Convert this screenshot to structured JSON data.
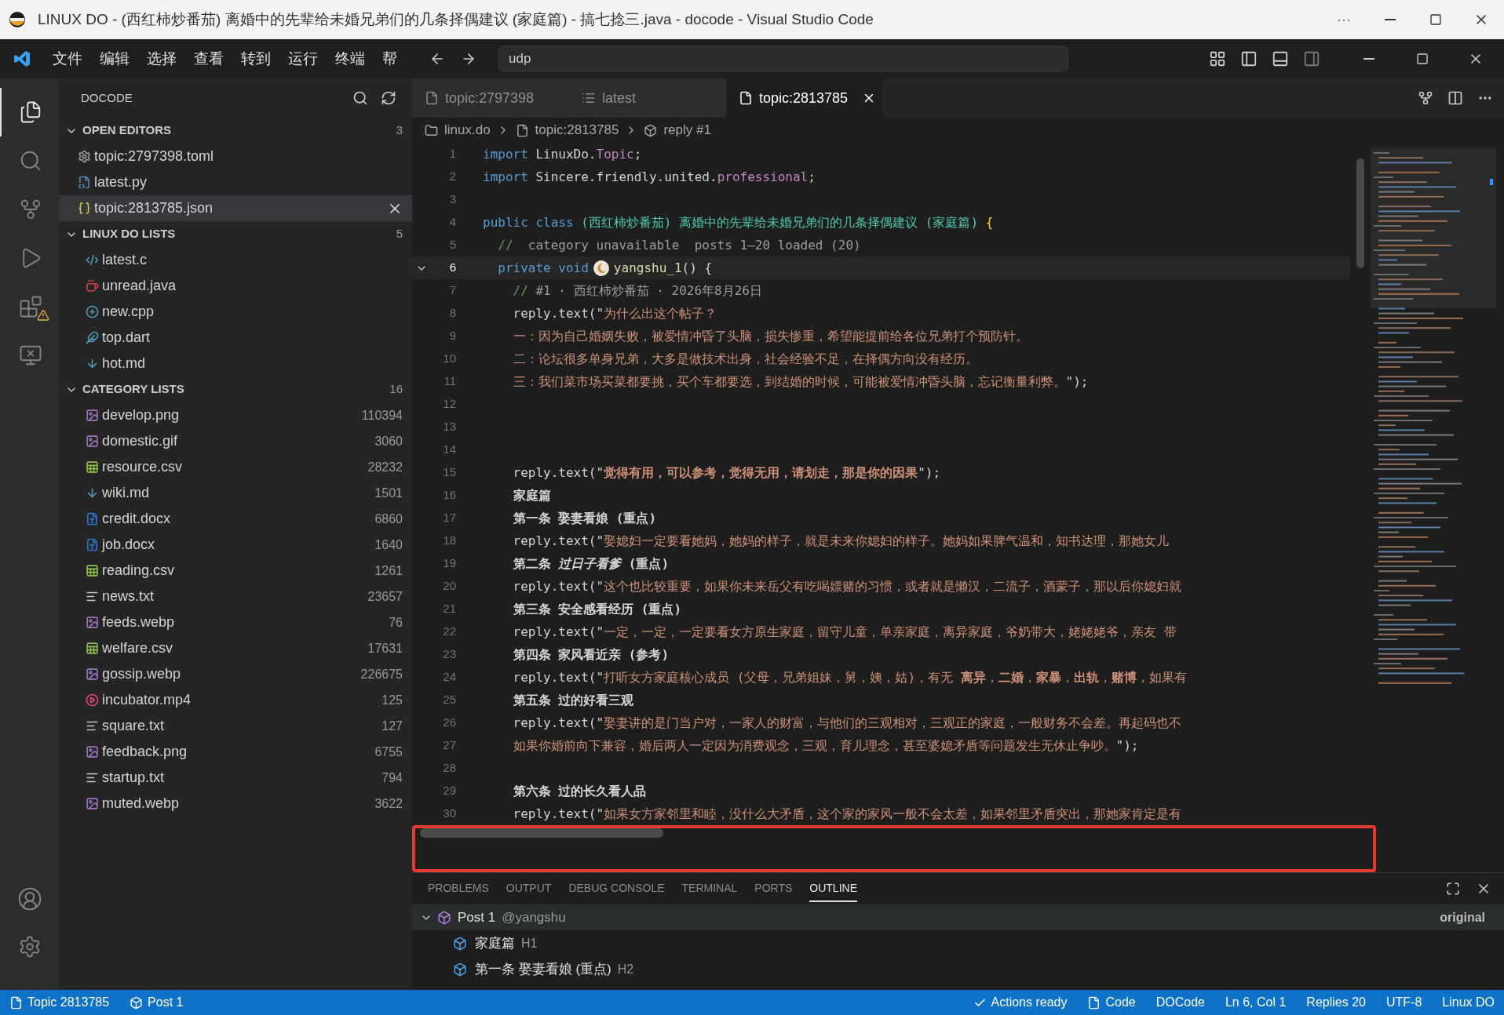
{
  "window": {
    "title": "LINUX DO - (西红柿炒番茄) 离婚中的先辈给未婚兄弟们的几条择偶建议 (家庭篇) - 搞七捻三.java - docode - Visual Studio Code",
    "more": "···"
  },
  "menu": {
    "items": [
      "文件",
      "编辑",
      "选择",
      "查看",
      "转到",
      "运行",
      "终端",
      "帮"
    ],
    "search": {
      "value": "udp"
    }
  },
  "activity_bar": [
    {
      "kind": "files",
      "selected": true
    },
    {
      "kind": "search",
      "selected": false
    },
    {
      "kind": "source-control",
      "selected": false
    },
    {
      "kind": "debug",
      "selected": false
    },
    {
      "kind": "extensions",
      "selected": false
    },
    {
      "kind": "remote",
      "selected": false
    }
  ],
  "sidebar": {
    "title": "DOCODE",
    "sections": [
      {
        "title": "OPEN EDITORS",
        "count": "3",
        "expanded": true,
        "items": [
          {
            "name": "topic:2797398.toml",
            "kind": "settings",
            "selected": false
          },
          {
            "name": "latest.py",
            "kind": "python",
            "selected": false
          },
          {
            "name": "topic:2813785.json",
            "kind": "json",
            "selected": true
          }
        ]
      },
      {
        "title": "LINUX DO LISTS",
        "count": "5",
        "expanded": true,
        "items": [
          {
            "name": "latest.c",
            "kind": "c",
            "selected": false
          },
          {
            "name": "unread.java",
            "kind": "java",
            "selected": false
          },
          {
            "name": "new.cpp",
            "kind": "cpp",
            "selected": false
          },
          {
            "name": "top.dart",
            "kind": "dart",
            "selected": false
          },
          {
            "name": "hot.md",
            "kind": "markdown",
            "selected": false
          }
        ]
      },
      {
        "title": "CATEGORY LISTS",
        "count": "16",
        "expanded": true,
        "items": [
          {
            "name": "develop.png",
            "kind": "image",
            "count": "110394",
            "selected": false
          },
          {
            "name": "domestic.gif",
            "kind": "image",
            "count": "3060",
            "selected": false
          },
          {
            "name": "resource.csv",
            "kind": "table",
            "count": "28232",
            "selected": false
          },
          {
            "name": "wiki.md",
            "kind": "markdown",
            "count": "1501",
            "selected": false
          },
          {
            "name": "credit.docx",
            "kind": "word",
            "count": "6860",
            "selected": false
          },
          {
            "name": "job.docx",
            "kind": "word",
            "count": "1640",
            "selected": false
          },
          {
            "name": "reading.csv",
            "kind": "table",
            "count": "1261",
            "selected": false
          },
          {
            "name": "news.txt",
            "kind": "text",
            "count": "23657",
            "selected": false
          },
          {
            "name": "feeds.webp",
            "kind": "image",
            "count": "76",
            "selected": false
          },
          {
            "name": "welfare.csv",
            "kind": "table",
            "count": "17631",
            "selected": false
          },
          {
            "name": "gossip.webp",
            "kind": "image",
            "count": "226675",
            "selected": false
          },
          {
            "name": "incubator.mp4",
            "kind": "video",
            "count": "125",
            "selected": false
          },
          {
            "name": "square.txt",
            "kind": "text",
            "count": "127",
            "selected": false
          },
          {
            "name": "feedback.png",
            "kind": "image",
            "count": "6755",
            "selected": false
          },
          {
            "name": "startup.txt",
            "kind": "text",
            "count": "794",
            "selected": false
          },
          {
            "name": "muted.webp",
            "kind": "image",
            "count": "3622",
            "selected": false
          }
        ]
      }
    ]
  },
  "tabs": [
    {
      "label": "topic:2797398",
      "kind": "file",
      "selected": false
    },
    {
      "label": "latest",
      "kind": "list",
      "selected": false
    },
    {
      "label": "topic:2813785",
      "kind": "file",
      "selected": true
    }
  ],
  "breadcrumb": [
    {
      "label": "linux.do",
      "kind": "folder"
    },
    {
      "label": "topic:2813785",
      "kind": "file"
    },
    {
      "label": "reply #1",
      "kind": "box"
    }
  ],
  "code": {
    "lines": [
      {
        "number": "1",
        "segments": [
          {
            "kind": "keyword",
            "text": "import"
          },
          {
            "kind": "plain",
            "text": " LinuxDo."
          },
          {
            "kind": "type",
            "text": "Topic"
          },
          {
            "kind": "plain",
            "text": ";"
          }
        ]
      },
      {
        "number": "2",
        "segments": [
          {
            "kind": "keyword",
            "text": "import"
          },
          {
            "kind": "plain",
            "text": " Sincere.friendly.united."
          },
          {
            "kind": "type",
            "text": "professional"
          },
          {
            "kind": "plain",
            "text": ";"
          }
        ]
      },
      {
        "number": "3"
      },
      {
        "number": "4",
        "segments": [
          {
            "kind": "keyword",
            "text": "public class"
          },
          {
            "kind": "class-name",
            "text": " (西红柿炒番茄) 离婚中的先辈给未婚兄弟们的几条择偶建议 (家庭篇)"
          },
          {
            "kind": "brace",
            "text": " {"
          }
        ]
      },
      {
        "number": "5",
        "segments": [
          {
            "kind": "comment-mark",
            "text": "  //"
          },
          {
            "kind": "comment",
            "text": "  category unavailable  posts 1–20 loaded (20)"
          }
        ]
      },
      {
        "number": "6",
        "current": true,
        "expanded": true,
        "segments": [
          {
            "kind": "keyword",
            "text": "  private void"
          },
          {
            "kind": "avatar"
          },
          {
            "kind": "method",
            "text": "yangshu_1"
          },
          {
            "kind": "plain",
            "text": "() {"
          }
        ]
      },
      {
        "number": "7",
        "segments": [
          {
            "kind": "comment-mark",
            "text": "    //"
          },
          {
            "kind": "comment",
            "text": " #1 · 西红柿炒番茄 · 2026年8月26日"
          }
        ]
      },
      {
        "number": "8",
        "segments": [
          {
            "kind": "plain",
            "text": "    reply.text(\""
          },
          {
            "kind": "string",
            "text": "为什么出这个帖子？"
          }
        ]
      },
      {
        "number": "9",
        "segments": [
          {
            "kind": "string",
            "text": "    一：因为自己婚姻失败，被爱情冲昏了头脑，损失惨重，希望能提前给各位兄弟打个预防针。"
          }
        ]
      },
      {
        "number": "10",
        "segments": [
          {
            "kind": "string",
            "text": "    二：论坛很多单身兄弟，大多是做技术出身，社会经验不足，在择偶方向没有经历。"
          }
        ]
      },
      {
        "number": "11",
        "segments": [
          {
            "kind": "string",
            "text": "    三：我们菜市场买菜都要挑，买个车都要选，到结婚的时候，可能被爱情冲昏头脑，忘记衡量利弊。"
          },
          {
            "kind": "plain",
            "text": "\");"
          }
        ]
      },
      {
        "number": "12"
      },
      {
        "number": "13"
      },
      {
        "number": "14"
      },
      {
        "number": "15",
        "segments": [
          {
            "kind": "plain",
            "text": "    reply.text(\""
          },
          {
            "kind": "string-bold",
            "text": "觉得有用，可以参考，觉得无用，请划走，那是你的因果"
          },
          {
            "kind": "plain",
            "text": "\");"
          }
        ]
      },
      {
        "number": "16",
        "segments": [
          {
            "kind": "heading",
            "text": "    家庭篇"
          }
        ]
      },
      {
        "number": "17",
        "segments": [
          {
            "kind": "heading",
            "text": "    第一条 娶妻看娘 (重点)"
          }
        ]
      },
      {
        "number": "18",
        "segments": [
          {
            "kind": "plain",
            "text": "    reply.text(\""
          },
          {
            "kind": "string",
            "text": "娶媳妇一定要看她妈，她妈的样子，就是未来你媳妇的样子。她妈如果脾气温和，知书达理，那她女儿"
          }
        ]
      },
      {
        "number": "19",
        "segments": [
          {
            "kind": "heading",
            "text": "    第二条 *过日子看爹* (重点)"
          }
        ]
      },
      {
        "number": "20",
        "segments": [
          {
            "kind": "plain",
            "text": "    reply.text(\""
          },
          {
            "kind": "string",
            "text": "这个也比较重要，如果你未来岳父有吃喝嫖赌的习惯，或者就是懒汉，二流子，酒蒙子，那以后你媳妇就"
          }
        ]
      },
      {
        "number": "21",
        "segments": [
          {
            "kind": "heading",
            "text": "    第三条 安全感看经历 (重点)"
          }
        ]
      },
      {
        "number": "22",
        "segments": [
          {
            "kind": "plain",
            "text": "    reply.text(\""
          },
          {
            "kind": "string",
            "text": "一定，一定，一定要看女方原生家庭，留守儿童，单亲家庭，离异家庭，爷奶带大，姥姥姥爷，亲友 带"
          }
        ]
      },
      {
        "number": "23",
        "segments": [
          {
            "kind": "heading",
            "text": "    第四条 家风看近亲 (参考)"
          }
        ]
      },
      {
        "number": "24",
        "segments": [
          {
            "kind": "plain",
            "text": "    reply.text(\""
          },
          {
            "kind": "string",
            "text": "打听女方家庭核心成员 (父母，兄弟姐妹，舅，姨，姑)，有无 **离异**，**二婚**，**家暴**，**出轨**，**赌博**，如果有"
          }
        ]
      },
      {
        "number": "25",
        "segments": [
          {
            "kind": "heading",
            "text": "    第五条 过的好看三观"
          }
        ]
      },
      {
        "number": "26",
        "segments": [
          {
            "kind": "plain",
            "text": "    reply.text(\""
          },
          {
            "kind": "string",
            "text": "娶妻讲的是门当户对，一家人的财富，与他们的三观相对，三观正的家庭，一般财务不会差。再起码也不"
          }
        ]
      },
      {
        "number": "27",
        "segments": [
          {
            "kind": "string",
            "text": "    如果你婚前向下兼容，婚后两人一定因为消费观念，三观，育儿理念，甚至婆媳矛盾等问题发生无休止争吵。"
          },
          {
            "kind": "plain",
            "text": "\");"
          }
        ]
      },
      {
        "number": "28"
      },
      {
        "number": "29",
        "segments": [
          {
            "kind": "heading",
            "text": "    第六条 过的长久看人品"
          }
        ]
      },
      {
        "number": "30",
        "segments": [
          {
            "kind": "plain",
            "text": "    reply.text(\""
          },
          {
            "kind": "string",
            "text": "如果女方家邻里和睦，没什么大矛盾，这个家的家风一般不会太差，如果邻里矛盾突出，那她家肯定是有"
          }
        ]
      }
    ]
  },
  "panel": {
    "tabs": [
      {
        "label": "PROBLEMS",
        "selected": false
      },
      {
        "label": "OUTPUT",
        "selected": false
      },
      {
        "label": "DEBUG CONSOLE",
        "selected": false
      },
      {
        "label": "TERMINAL",
        "selected": false
      },
      {
        "label": "PORTS",
        "selected": false
      },
      {
        "label": "OUTLINE",
        "selected": true
      }
    ],
    "outline": [
      {
        "label": "Post 1",
        "detail": "@yangshu",
        "badge": "original",
        "expanded": true,
        "children": [
          {
            "label": "家庭篇",
            "detail": "H1"
          },
          {
            "label": "第一条 娶妻看娘 (重点)",
            "detail": "H2"
          }
        ]
      }
    ]
  },
  "status_bar": {
    "left": [
      {
        "text": "Topic 2813785",
        "kind": "file"
      },
      {
        "text": "Post 1",
        "kind": "box"
      }
    ],
    "right": [
      {
        "text": "Actions ready",
        "kind": "check"
      },
      {
        "text": "Code",
        "kind": "file"
      },
      {
        "text": "DOCode"
      },
      {
        "text": "Ln 6, Col 1"
      },
      {
        "text": "Replies 20"
      },
      {
        "text": "UTF-8"
      },
      {
        "text": "Linux DO"
      }
    ]
  }
}
